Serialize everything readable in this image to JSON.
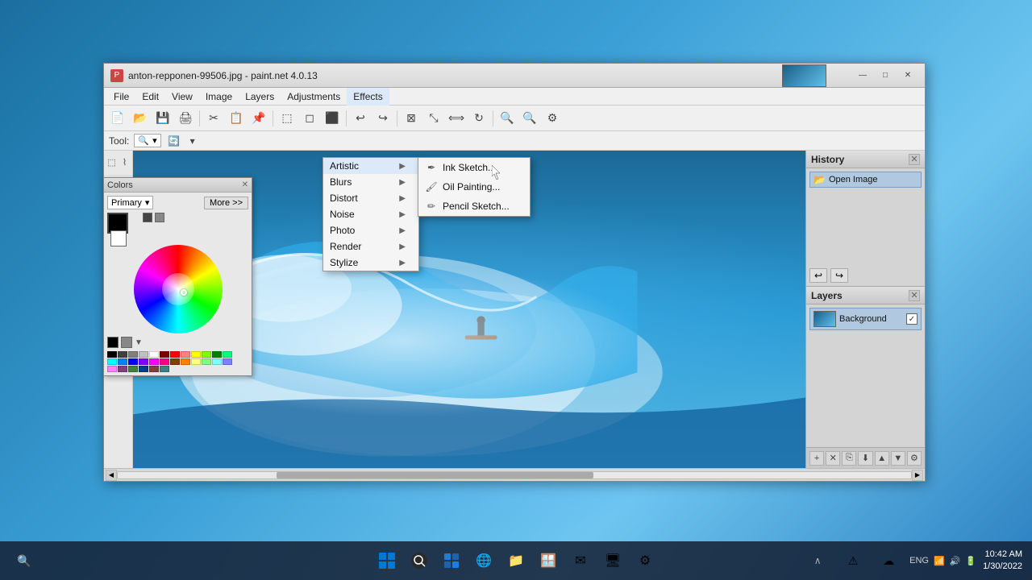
{
  "window": {
    "title": "anton-repponen-99506.jpg - paint.net 4.0.13",
    "icon": "P"
  },
  "titlebar": {
    "minimize": "—",
    "maximize": "□",
    "close": "✕"
  },
  "menubar": {
    "items": [
      {
        "label": "File",
        "id": "file"
      },
      {
        "label": "Edit",
        "id": "edit"
      },
      {
        "label": "View",
        "id": "view"
      },
      {
        "label": "Image",
        "id": "image"
      },
      {
        "label": "Layers",
        "id": "layers"
      },
      {
        "label": "Adjustments",
        "id": "adjustments"
      },
      {
        "label": "Effects",
        "id": "effects",
        "active": true
      }
    ]
  },
  "toolselect": {
    "label": "Tool:"
  },
  "effects_menu": {
    "items": [
      {
        "label": "Artistic",
        "id": "artistic",
        "has_sub": true,
        "active": true
      },
      {
        "label": "Blurs",
        "id": "blurs",
        "has_sub": true
      },
      {
        "label": "Distort",
        "id": "distort",
        "has_sub": true
      },
      {
        "label": "Noise",
        "id": "noise",
        "has_sub": true
      },
      {
        "label": "Photo",
        "id": "photo",
        "has_sub": true
      },
      {
        "label": "Render",
        "id": "render",
        "has_sub": true
      },
      {
        "label": "Stylize",
        "id": "stylize",
        "has_sub": true
      }
    ]
  },
  "artistic_submenu": {
    "items": [
      {
        "label": "Ink Sketch...",
        "id": "ink-sketch"
      },
      {
        "label": "Oil Painting...",
        "id": "oil-painting"
      },
      {
        "label": "Pencil Sketch...",
        "id": "pencil-sketch"
      }
    ]
  },
  "history_panel": {
    "title": "History",
    "items": [
      {
        "label": "Open Image",
        "icon": "📂"
      }
    ]
  },
  "layers_panel": {
    "title": "Layers",
    "layers": [
      {
        "name": "Background",
        "visible": true
      }
    ]
  },
  "colors_panel": {
    "title": "Colors",
    "mode": "Primary",
    "more_btn": "More >>"
  },
  "taskbar": {
    "start": "⊞",
    "apps": [
      "⊞",
      "🔍",
      "📁",
      "🌐",
      "📁",
      "🪟",
      "✉",
      "🖥",
      "⚙"
    ],
    "time": "10:42 AM",
    "date": "1/30/2022",
    "lang": "ENG",
    "battery_icon": "🔋",
    "wifi_icon": "📶",
    "volume_icon": "🔊"
  },
  "palette_colors": [
    "#000000",
    "#404040",
    "#808080",
    "#c0c0c0",
    "#ffffff",
    "#800000",
    "#ff0000",
    "#ff8080",
    "#ffff00",
    "#80ff00",
    "#008000",
    "#00ff80",
    "#00ffff",
    "#0080ff",
    "#0000ff",
    "#8000ff",
    "#ff00ff",
    "#ff0080",
    "#804000",
    "#ff8000",
    "#ffff80",
    "#80ff80",
    "#80ffff",
    "#8080ff",
    "#ff80ff",
    "#804080",
    "#408040",
    "#004080",
    "#804040",
    "#408080"
  ]
}
